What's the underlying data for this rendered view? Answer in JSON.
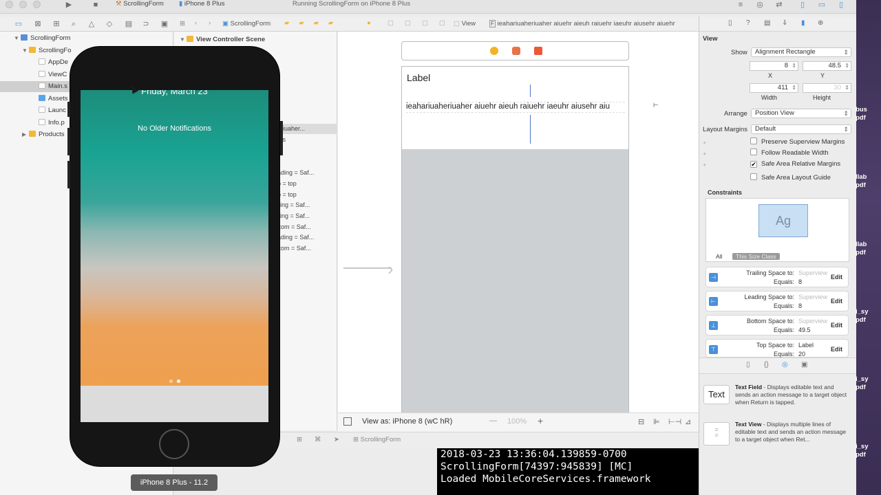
{
  "toolbar": {
    "scheme": "ScrollingForm",
    "device": "iPhone 8 Plus",
    "status": "Running ScrollingForm on iPhone 8 Plus"
  },
  "navigator": {
    "items": [
      {
        "label": "ScrollingForm",
        "kind": "proj"
      },
      {
        "label": "ScrollingFo",
        "kind": "folder"
      },
      {
        "label": "AppDe",
        "kind": "swift"
      },
      {
        "label": "ViewC",
        "kind": "swift"
      },
      {
        "label": "Main.s",
        "kind": "sb"
      },
      {
        "label": "Assets",
        "kind": "asset"
      },
      {
        "label": "Launc",
        "kind": "sb"
      },
      {
        "label": "Info.p",
        "kind": "plist"
      },
      {
        "label": "Products",
        "kind": "folder"
      }
    ]
  },
  "jumpbar": {
    "crumbs": [
      "ScrollingForm",
      "View",
      "ieahariuaheriuaher aiuehr aieuh raiuehr iaeuhr aiusehr aiuehr"
    ]
  },
  "outline": {
    "scene": "View Controller Scene",
    "rows": [
      "eriuaher...",
      "nts",
      "ading = Saf...",
      "p = top",
      "p = top",
      "iling = Saf...",
      "iling = Saf...",
      "ttom = Saf...",
      "ading = Saf...",
      "ttom = Saf..."
    ]
  },
  "canvas": {
    "label_text": "Label",
    "long_text": "ieahariuaheriuaher aiuehr aieuh raiuehr iaeuhr aiusehr aiu",
    "view_as": "View as: iPhone 8 (wC hR)",
    "zoom": "100%",
    "scene_colors": {
      "yellow": "#f2b325",
      "orange": "#e8734a",
      "red": "#ea5a36"
    }
  },
  "debug": {
    "target": "ScrollingForm"
  },
  "console": {
    "lines": [
      "2018-03-23 13:36:04.139859-0700",
      "ScrollingForm[74397:945839] [MC]",
      "Loaded MobileCoreServices.framework"
    ]
  },
  "inspector": {
    "section": "View",
    "show_label": "Show",
    "show_value": "Alignment Rectangle",
    "x": "8",
    "y": "48.5",
    "width": "411",
    "height": "30",
    "x_label": "X",
    "y_label": "Y",
    "width_label": "Width",
    "height_label": "Height",
    "arrange_label": "Arrange",
    "arrange_value": "Position View",
    "margins_label": "Layout Margins",
    "margins_value": "Default",
    "checks": [
      {
        "label": "Preserve Superview Margins",
        "checked": false
      },
      {
        "label": "Follow Readable Width",
        "checked": false
      },
      {
        "label": "Safe Area Relative Margins",
        "checked": true
      },
      {
        "label": "Safe Area Layout Guide",
        "checked": false
      }
    ],
    "constraints_title": "Constraints",
    "preview_text": "Ag",
    "all_label": "All",
    "size_class_label": "This Size Class",
    "constraints": [
      {
        "name": "Trailing Space to:",
        "target": "Superview",
        "equals": "Equals:",
        "value": "8",
        "edit": "Edit"
      },
      {
        "name": "Leading Space to:",
        "target": "Superview",
        "equals": "Equals:",
        "value": "8",
        "edit": "Edit"
      },
      {
        "name": "Bottom Space to:",
        "target": "Superview",
        "equals": "Equals:",
        "value": "49.5",
        "edit": "Edit"
      },
      {
        "name": "Top Space to:",
        "target": "Label",
        "equals": "Equals:",
        "value": "20",
        "edit": "Edit"
      }
    ]
  },
  "library": [
    {
      "icon": "Text",
      "title": "Text Field",
      "desc": " - Displays editable text and sends an action message to a target object when Return is tapped."
    },
    {
      "icon": "",
      "title": "Text View",
      "desc": " - Displays multiple lines of editable text and sends an action message to a target object when Ret..."
    }
  ],
  "right_strip": [
    "bus",
    "pdf",
    "llab",
    "pdf",
    "llab",
    "pdf",
    "i_sy",
    "pdf",
    "i_sy",
    "pdf",
    "i_sy",
    "pdf"
  ],
  "simulator": {
    "date": "Friday, March 23",
    "notification": "No Older Notifications",
    "label": "iPhone 8 Plus - 11.2"
  }
}
